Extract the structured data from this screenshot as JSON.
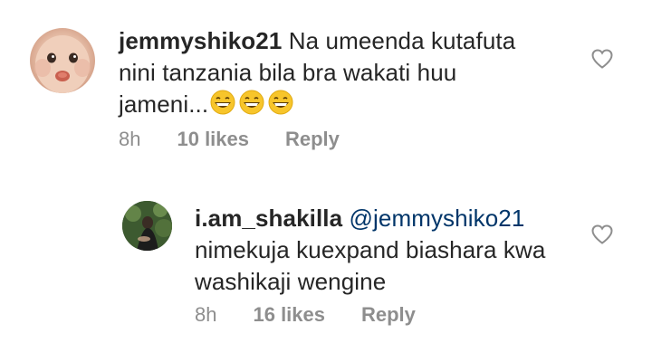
{
  "comments": [
    {
      "username": "jemmyshiko21",
      "text": "Na umeenda kutafuta nini tanzania bila bra wakati huu jameni...",
      "emoji": "😁😁😁",
      "time": "8h",
      "likes": "10 likes",
      "reply_label": "Reply",
      "like_icon": "heart-outline-icon"
    },
    {
      "username": "i.am_shakilla",
      "mention": "@jemmyshiko21",
      "text": "nimekuja kuexpand biashara kwa washikaji wengine",
      "time": "8h",
      "likes": "16 likes",
      "reply_label": "Reply",
      "like_icon": "heart-outline-icon"
    }
  ],
  "colors": {
    "text": "#262626",
    "meta": "#8e8e8e",
    "mention": "#003569"
  }
}
